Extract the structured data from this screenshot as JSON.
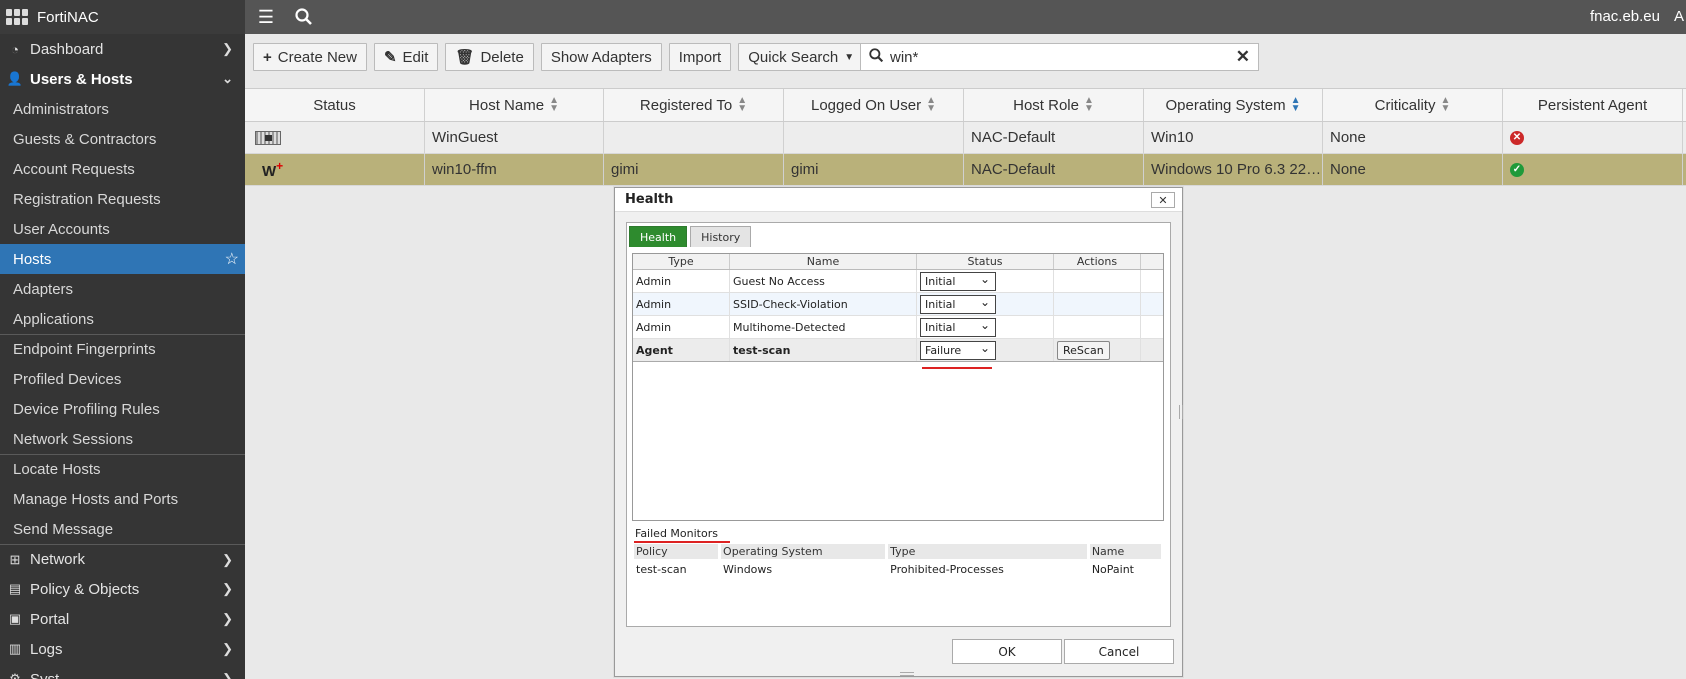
{
  "app": {
    "brand": "FortiNAC",
    "hostname": "fnac.eb.eu",
    "user_fragment": "A"
  },
  "sidebar": {
    "dashboard": "Dashboard",
    "users_hosts": "Users & Hosts",
    "items": [
      "Administrators",
      "Guests & Contractors",
      "Account Requests",
      "Registration Requests",
      "User Accounts",
      "Hosts",
      "Adapters",
      "Applications",
      "Endpoint Fingerprints",
      "Profiled Devices",
      "Device Profiling Rules",
      "Network Sessions",
      "Locate Hosts",
      "Manage Hosts and Ports",
      "Send Message"
    ],
    "network": "Network",
    "policy": "Policy & Objects",
    "portal": "Portal",
    "logs": "Logs",
    "system_fragment": "Syst"
  },
  "toolbar": {
    "create_new": "Create New",
    "edit": "Edit",
    "delete": "Delete",
    "show_adapters": "Show Adapters",
    "import": "Import",
    "quick_search": "Quick Search"
  },
  "search": {
    "value": "win*"
  },
  "table": {
    "columns": [
      "Status",
      "Host Name",
      "Registered To",
      "Logged On User",
      "Host Role",
      "Operating System",
      "Criticality",
      "Persistent Agent"
    ],
    "rows": [
      {
        "host": "WinGuest",
        "registered": "",
        "logged": "",
        "role": "NAC-Default",
        "os": "Win10",
        "criticality": "None",
        "agent": "error"
      },
      {
        "badge": "W",
        "host": "win10-ffm",
        "registered": "gimi",
        "logged": "gimi",
        "role": "NAC-Default",
        "os": "Windows 10 Pro 6.3 22…",
        "criticality": "None",
        "agent": "ok"
      }
    ]
  },
  "dialog": {
    "title": "Health",
    "tabs": [
      "Health",
      "History"
    ],
    "columns": [
      "Type",
      "Name",
      "Status",
      "Actions"
    ],
    "rows": [
      {
        "type": "Admin",
        "name": "Guest No Access",
        "status": "Initial",
        "action": ""
      },
      {
        "type": "Admin",
        "name": "SSID-Check-Violation",
        "status": "Initial",
        "action": ""
      },
      {
        "type": "Admin",
        "name": "Multihome-Detected",
        "status": "Initial",
        "action": ""
      },
      {
        "type": "Agent",
        "name": "test-scan",
        "status": "Failure",
        "action": "ReScan"
      }
    ],
    "failed_monitors": {
      "label": "Failed Monitors",
      "columns": [
        "Policy",
        "Operating System",
        "Type",
        "Name"
      ],
      "row": [
        "test-scan",
        "Windows",
        "Prohibited-Processes",
        "NoPaint"
      ]
    },
    "ok": "OK",
    "cancel": "Cancel"
  }
}
